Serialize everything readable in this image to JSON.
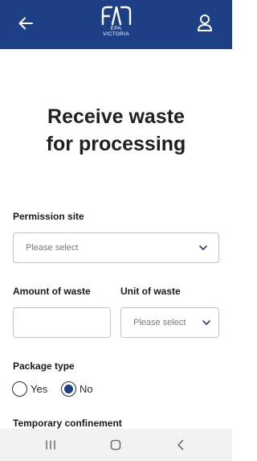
{
  "header": {
    "logo_line1": "EPA",
    "logo_line2": "VICTORIA",
    "brand_color": "#1d3f86",
    "icons": {
      "back": "arrow-left-icon",
      "user": "user-icon"
    }
  },
  "page": {
    "title_line1": "Receive waste",
    "title_line2": "for processing"
  },
  "form": {
    "permission_site": {
      "label": "Permission site",
      "placeholder": "Please select"
    },
    "amount_of_waste": {
      "label": "Amount of waste",
      "value": ""
    },
    "unit_of_waste": {
      "label": "Unit of waste",
      "placeholder": "Please select"
    },
    "package_type": {
      "label": "Package type",
      "options": [
        "Yes",
        "No"
      ],
      "selected": "No"
    },
    "temporary_confinement": {
      "label": "Temporary confinement"
    }
  },
  "system_nav": {
    "icons": [
      "recent-apps-icon",
      "home-icon",
      "back-icon"
    ]
  }
}
